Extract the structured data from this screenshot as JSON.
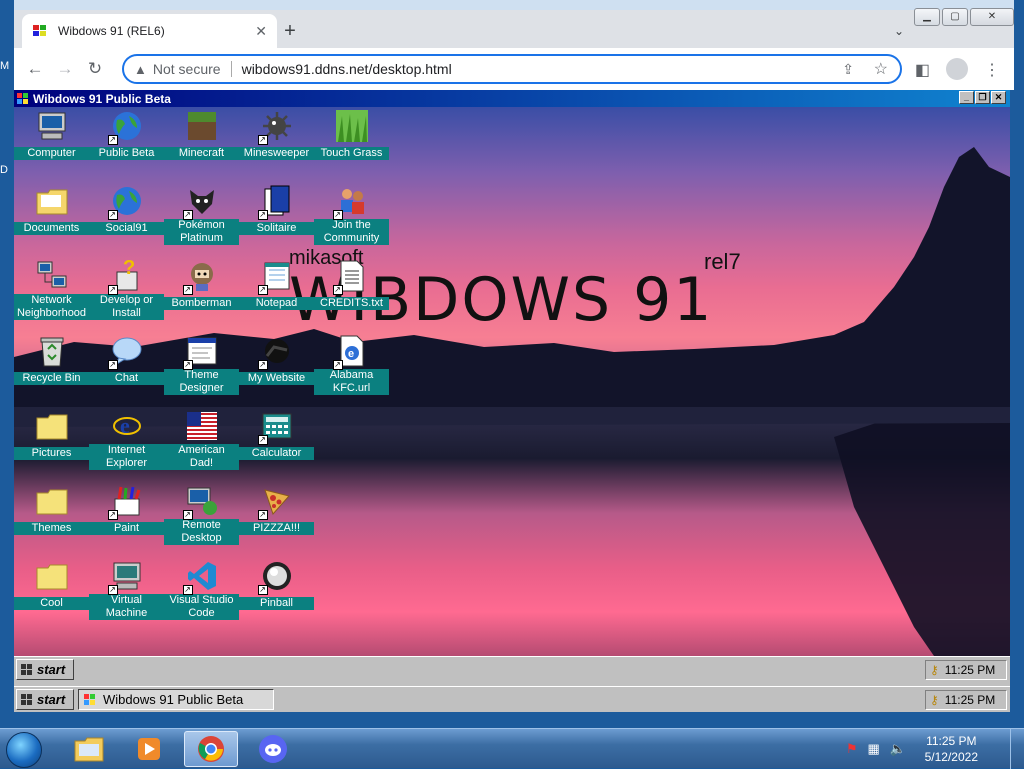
{
  "browser": {
    "tab_title": "Wibdows 91 (REL6)",
    "url_security": "Not secure",
    "url": "wibdows91.ddns.net/desktop.html"
  },
  "window": {
    "title": "Wibdows 91 Public Beta"
  },
  "desktop": {
    "brand_prefix": "mikasoft",
    "brand": "WIBDOWS 91",
    "release": "rel7",
    "icons": [
      {
        "label": "Computer",
        "icon": "computer-icon"
      },
      {
        "label": "Public Beta",
        "icon": "globe-icon"
      },
      {
        "label": "Minecraft",
        "icon": "grass-block-icon"
      },
      {
        "label": "Minesweeper",
        "icon": "mine-icon"
      },
      {
        "label": "Touch Grass",
        "icon": "grass-icon"
      },
      {
        "label": "Documents",
        "icon": "folder-icon"
      },
      {
        "label": "Social91",
        "icon": "globe-icon"
      },
      {
        "label": "Pokémon Platinum",
        "icon": "pokemon-icon"
      },
      {
        "label": "Solitaire",
        "icon": "cards-icon"
      },
      {
        "label": "Join the Community",
        "icon": "people-icon"
      },
      {
        "label": "Network Neighborhood",
        "icon": "network-icon"
      },
      {
        "label": "Develop or Install",
        "icon": "help-icon"
      },
      {
        "label": "Bomberman",
        "icon": "bomberman-icon"
      },
      {
        "label": "Notepad",
        "icon": "notepad-icon"
      },
      {
        "label": "CREDITS.txt",
        "icon": "text-file-icon"
      },
      {
        "label": "Recycle Bin",
        "icon": "recycle-bin-icon"
      },
      {
        "label": "Chat",
        "icon": "chat-bubble-icon"
      },
      {
        "label": "Theme Designer",
        "icon": "window-icon"
      },
      {
        "label": "My Website",
        "icon": "web-icon"
      },
      {
        "label": "Alabama KFC.url",
        "icon": "ie-shortcut-icon"
      },
      {
        "label": "Pictures",
        "icon": "folder-icon"
      },
      {
        "label": "Internet Explorer",
        "icon": "ie-icon"
      },
      {
        "label": "American Dad!",
        "icon": "flag-icon"
      },
      {
        "label": "Calculator",
        "icon": "calculator-icon"
      },
      {
        "label": "Themes",
        "icon": "folder-icon"
      },
      {
        "label": "Paint",
        "icon": "paint-icon"
      },
      {
        "label": "Remote Desktop",
        "icon": "remote-desktop-icon"
      },
      {
        "label": "PIZZZA!!!",
        "icon": "pizza-icon"
      },
      {
        "label": "Cool",
        "icon": "folder-icon"
      },
      {
        "label": "Virtual Machine",
        "icon": "vm-icon"
      },
      {
        "label": "Visual Studio Code",
        "icon": "vscode-icon"
      },
      {
        "label": "Pinball",
        "icon": "pinball-icon"
      }
    ]
  },
  "taskbar1": {
    "start": "start",
    "clock": "11:25 PM"
  },
  "taskbar2": {
    "start": "start",
    "task": "Wibdows 91 Public Beta",
    "clock": "11:25 PM"
  },
  "win7": {
    "time": "11:25 PM",
    "date": "5/12/2022"
  },
  "edge": {
    "m": "M",
    "d": "D"
  }
}
